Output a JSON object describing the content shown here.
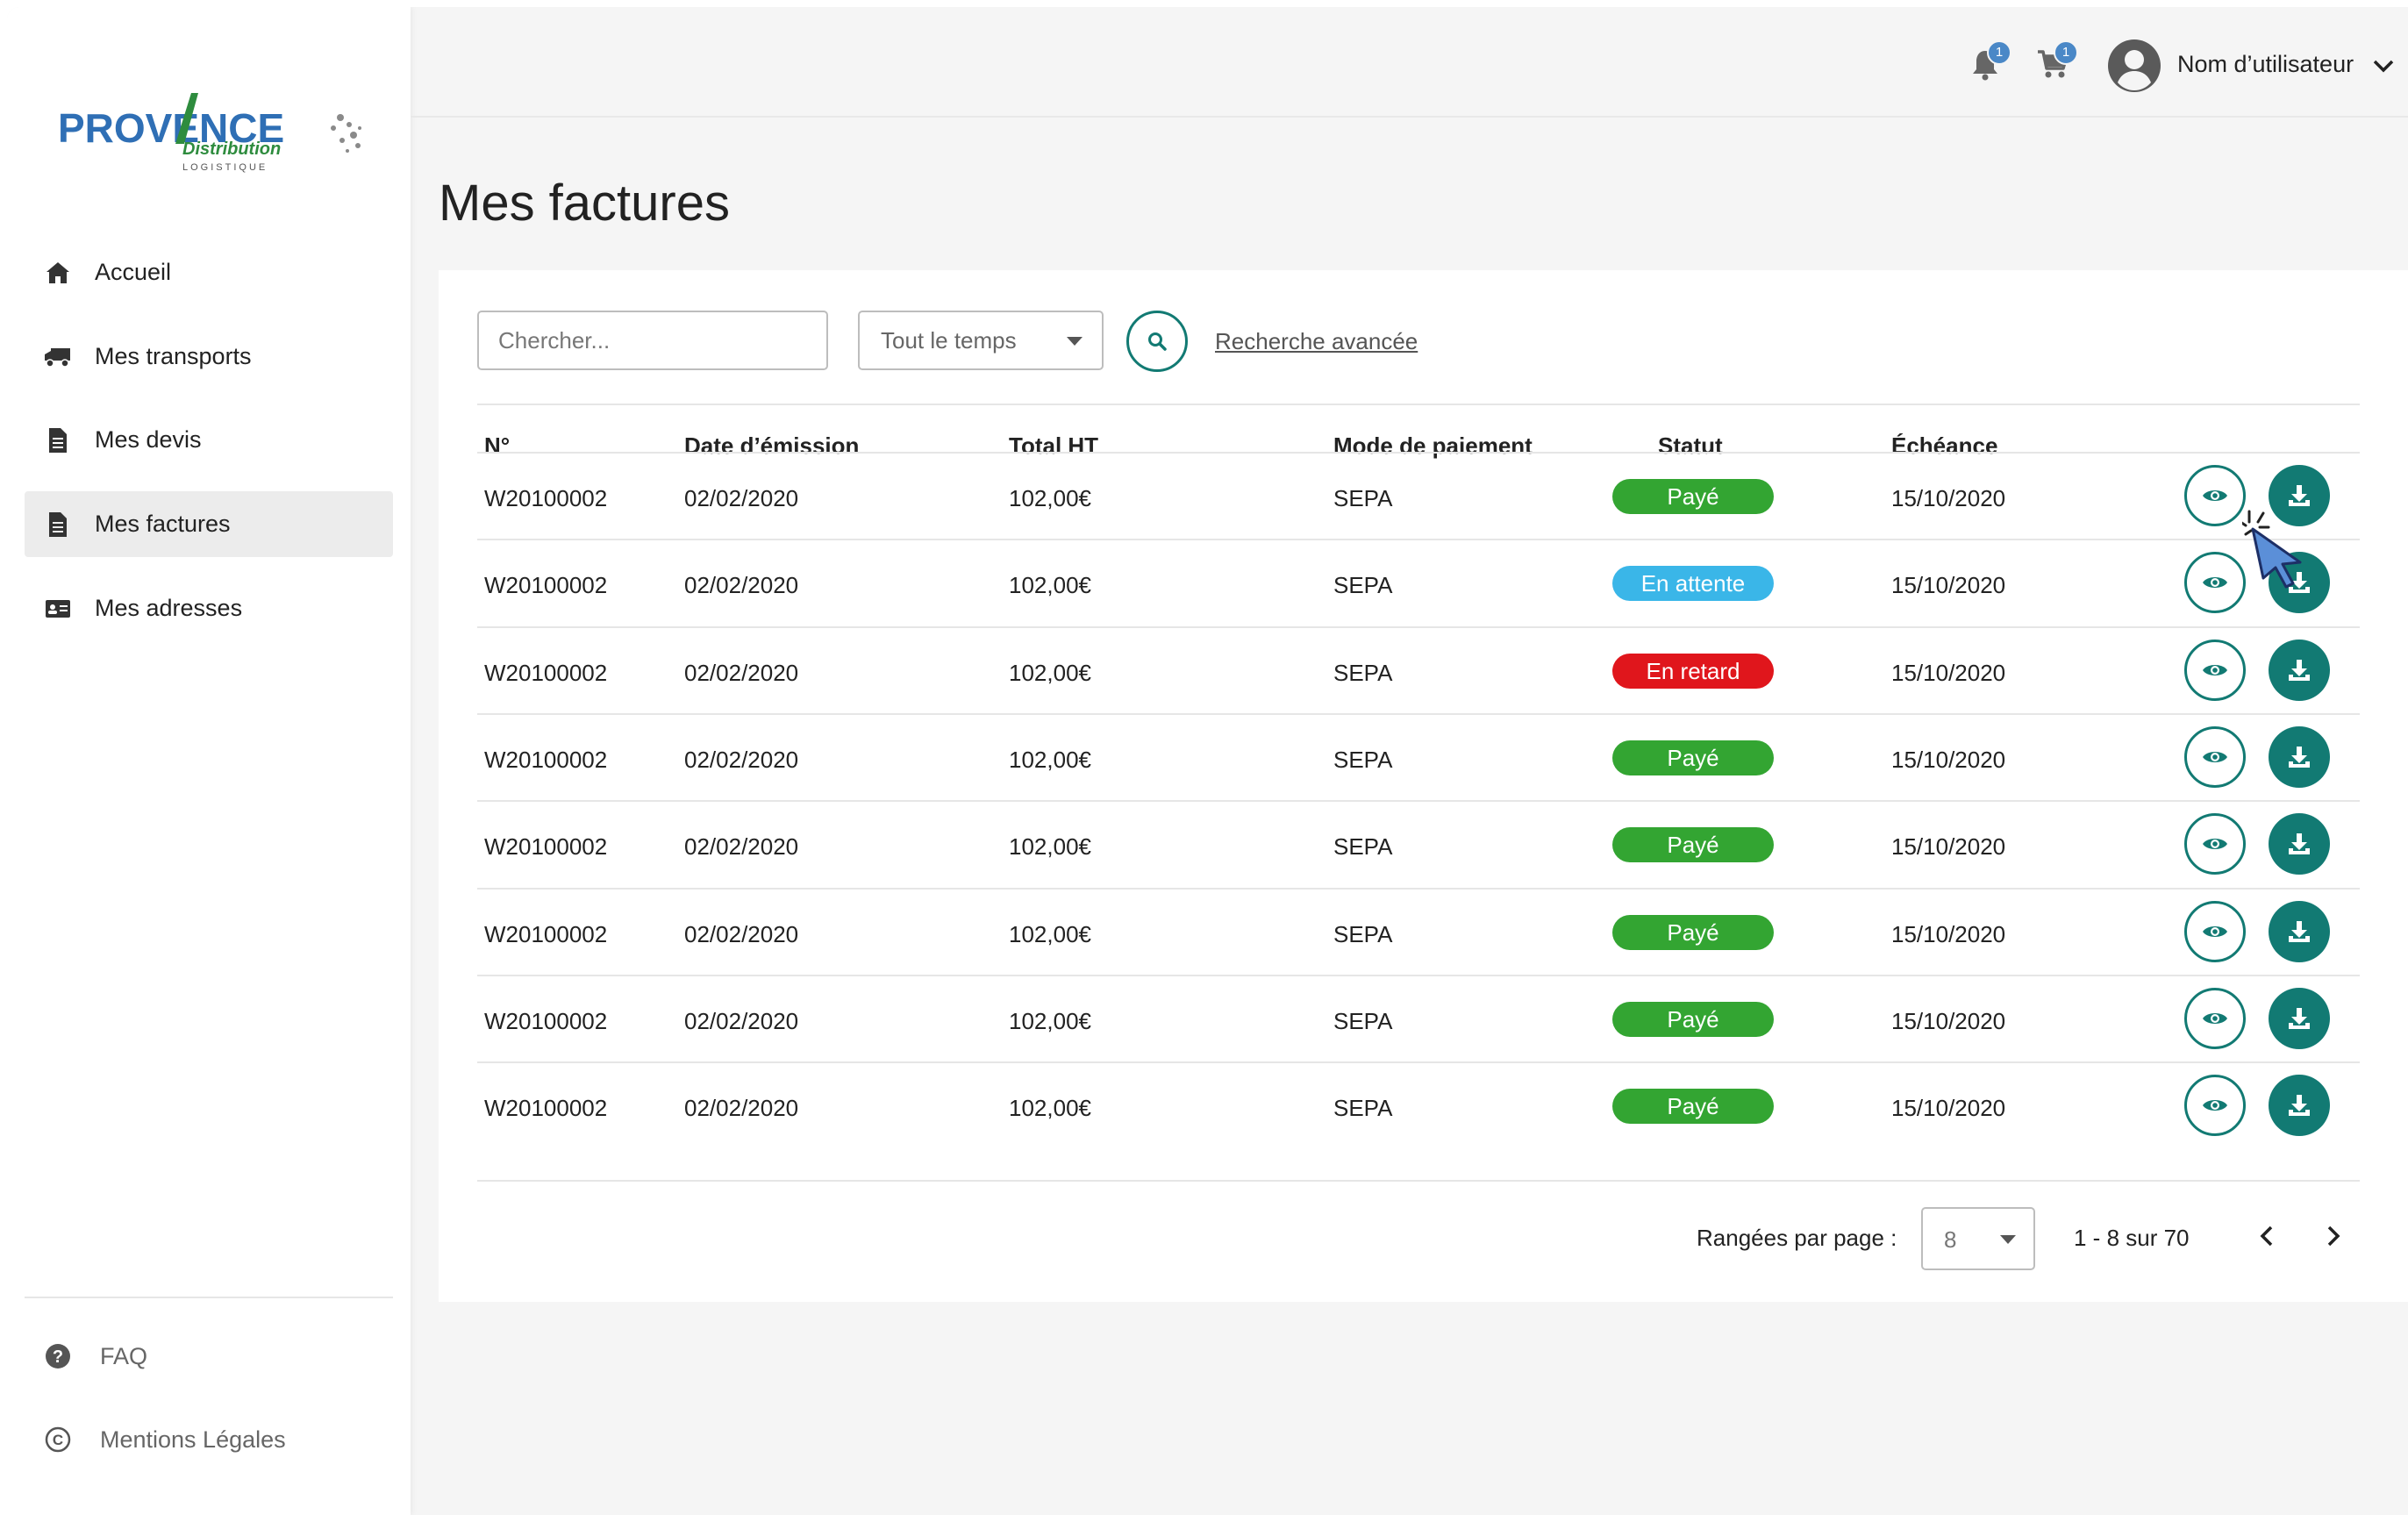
{
  "brand": {
    "logo_main": "PROVENCE",
    "logo_sub": "Distribution",
    "logo_tag": "LOGISTIQUE"
  },
  "sidebar": {
    "items": [
      {
        "label": "Accueil",
        "icon": "home-icon"
      },
      {
        "label": "Mes transports",
        "icon": "truck-icon"
      },
      {
        "label": "Mes devis",
        "icon": "document-icon"
      },
      {
        "label": "Mes factures",
        "icon": "document-icon",
        "active": true
      },
      {
        "label": "Mes adresses",
        "icon": "address-card-icon"
      }
    ],
    "footer": [
      {
        "label": "FAQ",
        "icon": "question-circle-icon"
      },
      {
        "label": "Mentions Légales",
        "icon": "copyright-icon"
      }
    ]
  },
  "header": {
    "notifications_count": "1",
    "cart_count": "1",
    "user_name": "Nom d’utilisateur"
  },
  "page": {
    "title": "Mes factures"
  },
  "filters": {
    "search_placeholder": "Chercher...",
    "period_selected": "Tout le temps",
    "advanced_search": "Recherche avancée"
  },
  "table": {
    "columns": [
      "N°",
      "Date d’émission",
      "Total HT",
      "Mode de paiement",
      "Statut",
      "Échéance"
    ],
    "rows": [
      {
        "num": "W20100002",
        "date": "02/02/2020",
        "total": "102,00€",
        "payment": "SEPA",
        "status": "Payé",
        "due": "15/10/2020"
      },
      {
        "num": "W20100002",
        "date": "02/02/2020",
        "total": "102,00€",
        "payment": "SEPA",
        "status": "En attente",
        "due": "15/10/2020"
      },
      {
        "num": "W20100002",
        "date": "02/02/2020",
        "total": "102,00€",
        "payment": "SEPA",
        "status": "En retard",
        "due": "15/10/2020"
      },
      {
        "num": "W20100002",
        "date": "02/02/2020",
        "total": "102,00€",
        "payment": "SEPA",
        "status": "Payé",
        "due": "15/10/2020"
      },
      {
        "num": "W20100002",
        "date": "02/02/2020",
        "total": "102,00€",
        "payment": "SEPA",
        "status": "Payé",
        "due": "15/10/2020"
      },
      {
        "num": "W20100002",
        "date": "02/02/2020",
        "total": "102,00€",
        "payment": "SEPA",
        "status": "Payé",
        "due": "15/10/2020"
      },
      {
        "num": "W20100002",
        "date": "02/02/2020",
        "total": "102,00€",
        "payment": "SEPA",
        "status": "Payé",
        "due": "15/10/2020"
      },
      {
        "num": "W20100002",
        "date": "02/02/2020",
        "total": "102,00€",
        "payment": "SEPA",
        "status": "Payé",
        "due": "15/10/2020"
      }
    ]
  },
  "status_colors": {
    "Payé": "#33a532",
    "En attente": "#3ab6e8",
    "En retard": "#e0161c"
  },
  "colors": {
    "accent": "#127a73",
    "badge": "#4a88c7",
    "logo_blue": "#2f6fb5",
    "logo_green": "#2e8c3e"
  },
  "pagination": {
    "rows_label": "Rangées par page :",
    "rows_value": "8",
    "range": "1 - 8 sur 70"
  }
}
